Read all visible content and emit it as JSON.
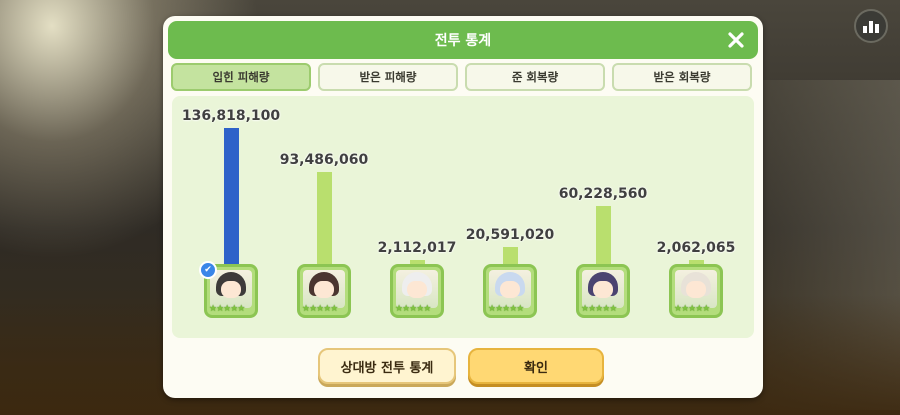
{
  "dialog": {
    "title": "전투 통계",
    "close_icon": "close-icon"
  },
  "tabs": [
    {
      "label": "입힌 피해량",
      "active": true
    },
    {
      "label": "받은 피해량",
      "active": false
    },
    {
      "label": "준 회복량",
      "active": false
    },
    {
      "label": "받은 회복량",
      "active": false
    }
  ],
  "chart_data": {
    "type": "bar",
    "categories": [
      "character-1",
      "character-2",
      "character-3",
      "character-4",
      "character-5",
      "character-6"
    ],
    "values": [
      136818100,
      93486060,
      2112017,
      20591020,
      60228560,
      2062065
    ],
    "labels": [
      "136,818,100",
      "93,486,060",
      "2,112,017",
      "20,591,020",
      "60,228,560",
      "2,062,065"
    ],
    "highlight_index": 0,
    "colors": {
      "top": "#2e62c9",
      "normal": "#b9df6e"
    }
  },
  "buttons": {
    "opponent_stats": "상대방 전투 통계",
    "confirm": "확인"
  },
  "icons": {
    "stats_toggle": "bar-chart-icon",
    "like_badge": "thumbs-up-icon"
  },
  "colors": {
    "header": "#6dbb4e",
    "active_tab": "#c4e39f",
    "chart_bg": "#eaf5d8",
    "confirm_button": "#ffd873"
  }
}
